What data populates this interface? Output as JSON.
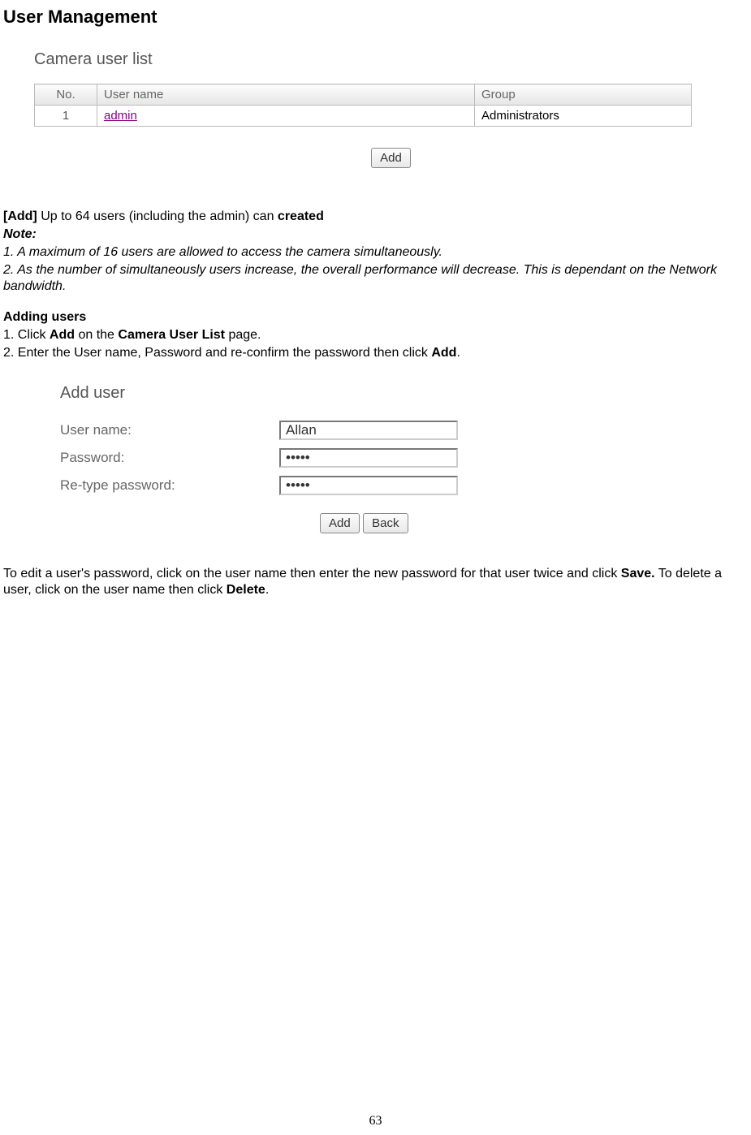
{
  "heading": "User Management",
  "figure1": {
    "title": "Camera user list",
    "columns": {
      "no": "No.",
      "user": "User name",
      "group": "Group"
    },
    "rows": [
      {
        "no": "1",
        "user": "admin",
        "group": "Administrators"
      }
    ],
    "add_btn": "Add"
  },
  "text": {
    "add_bold": "[Add] ",
    "add_rest": "Up to 64 users (including the admin) can ",
    "add_created": "created",
    "note_label": "Note:",
    "note1": "1. A maximum of 16 users are allowed to access the camera simultaneously.",
    "note2": "2. As the number of simultaneously users increase, the overall performance will decrease. This is dependant on the Network bandwidth.",
    "addusers_heading": "Adding users",
    "step1_a": "1. Click ",
    "step1_b": "Add",
    "step1_c": " on the ",
    "step1_d": "Camera User List",
    "step1_e": " page.",
    "step2_a": "2. Enter the User name, Password and re-confirm the password then click ",
    "step2_b": "Add",
    "step2_c": ".",
    "edit_a": "To edit a user's password, click on the user name then enter the new password for that user twice and click ",
    "edit_b": "Save.",
    "edit_c": " To delete a user, click on the user name then click ",
    "edit_d": "Delete",
    "edit_e": "."
  },
  "figure2": {
    "title": "Add user",
    "labels": {
      "username": "User name:",
      "password": "Password:",
      "retype": "Re-type password:"
    },
    "values": {
      "username": "Allan",
      "password": "•••••",
      "retype": "•••••"
    },
    "buttons": {
      "add": "Add",
      "back": "Back"
    }
  },
  "page_number": "63"
}
